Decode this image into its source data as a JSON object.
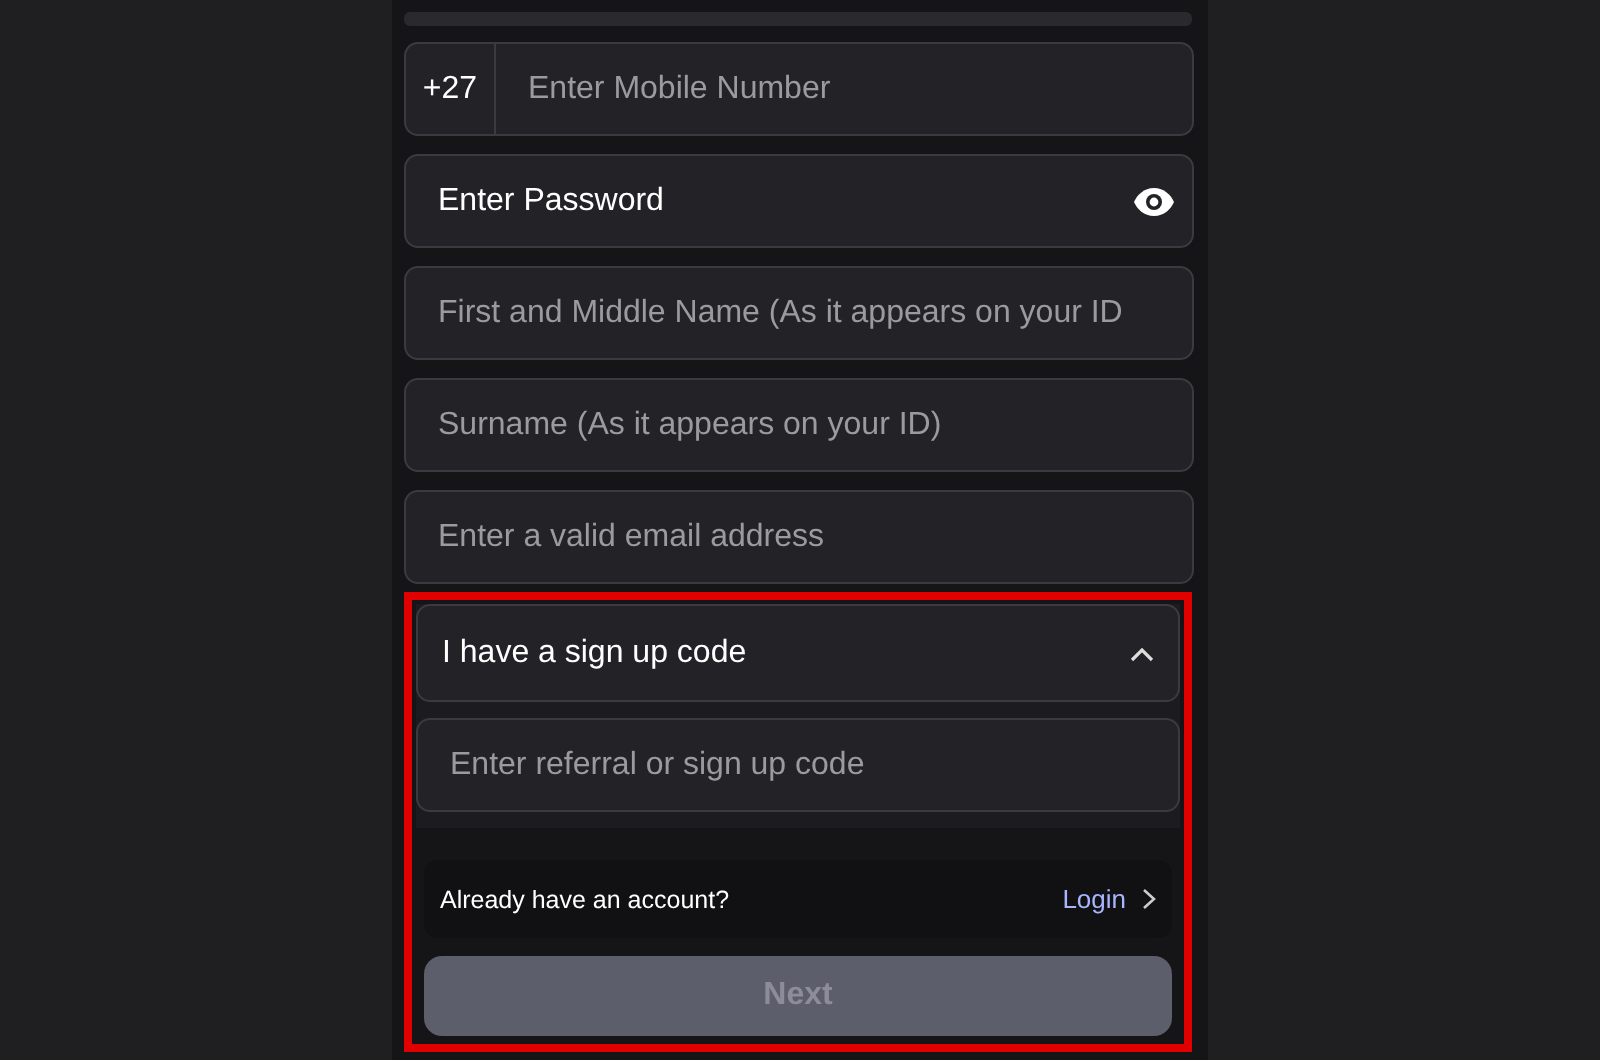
{
  "fields": [
    {
      "kind": "phone",
      "prefix": "+27",
      "placeholder": "Enter Mobile Number"
    },
    {
      "kind": "password",
      "label": "Enter Password"
    },
    {
      "kind": "text",
      "placeholder": "First and Middle Name (As it appears on your ID"
    },
    {
      "kind": "text",
      "placeholder": "Surname (As it appears on your ID)"
    },
    {
      "kind": "text",
      "placeholder": "Enter a valid email address"
    }
  ],
  "signup_code": {
    "highlighted": true,
    "title": "I have a sign up code",
    "expanded": true,
    "placeholder": "Enter referral or sign up code"
  },
  "login_row": {
    "text": "Already have an account?",
    "link": "Login"
  },
  "next_button": {
    "label": "Next",
    "disabled": true
  }
}
